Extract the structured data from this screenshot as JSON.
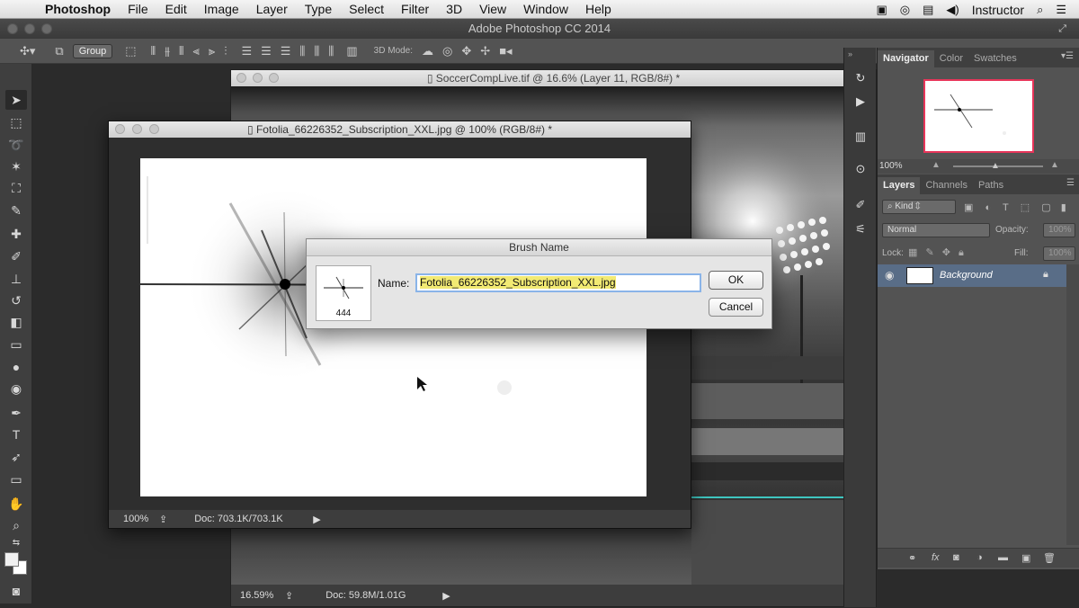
{
  "menubar": {
    "app": "Photoshop",
    "items": [
      "File",
      "Edit",
      "Image",
      "Layer",
      "Type",
      "Select",
      "Filter",
      "3D",
      "View",
      "Window",
      "Help"
    ],
    "user": "Instructor"
  },
  "app_title": "Adobe Photoshop CC 2014",
  "options_bar": {
    "auto_select": "Group",
    "mode_label": "3D Mode:"
  },
  "doc_soccer": {
    "title": "SoccerCompLive.tif @ 16.6% (Layer 11, RGB/8#) *",
    "zoom": "16.59%",
    "doc_size": "Doc: 59.8M/1.01G"
  },
  "doc_foto": {
    "title": "Fotolia_66226352_Subscription_XXL.jpg @ 100% (RGB/8#) *",
    "zoom": "100%",
    "doc_size": "Doc: 703.1K/703.1K"
  },
  "dialog": {
    "title": "Brush Name",
    "brush_size": "444",
    "name_label": "Name:",
    "name_value": "Fotolia_66226352_Subscription_XXL.jpg",
    "ok": "OK",
    "cancel": "Cancel"
  },
  "panels": {
    "top_tabs": [
      "Navigator",
      "Color",
      "Swatches"
    ],
    "nav_zoom": "100%",
    "layer_tabs": [
      "Layers",
      "Channels",
      "Paths"
    ],
    "kind": "Kind",
    "blend_mode": "Normal",
    "opacity_label": "Opacity:",
    "opacity_value": "100%",
    "lock_label": "Lock:",
    "fill_label": "Fill:",
    "fill_value": "100%",
    "layer_name": "Background"
  }
}
